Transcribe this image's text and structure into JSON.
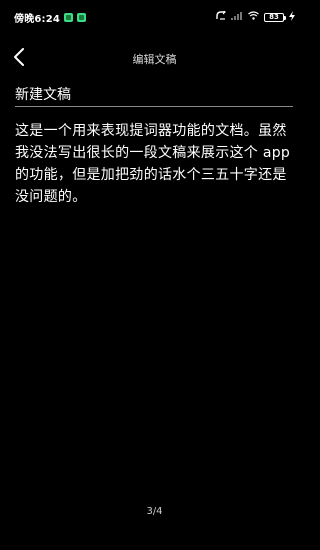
{
  "status_bar": {
    "time": "傍晚6:24",
    "battery": "83",
    "icons": [
      "notification-app-icon",
      "notification-app-icon",
      "data-activity-icon",
      "signal-icon",
      "wifi-icon",
      "battery-icon",
      "charging-icon"
    ]
  },
  "header": {
    "title": "编辑文稿",
    "back_icon": "chevron-left-icon"
  },
  "document": {
    "title": "新建文稿",
    "body": "这是一个用来表现提词器功能的文档。虽然我没法写出很长的一段文稿来展示这个 app 的功能，但是加把劲的话水个三五十字还是没问题的。"
  },
  "pagination": {
    "label": "3/4"
  },
  "colors": {
    "background": "#000000",
    "text": "#ffffff",
    "accent_notification": "#3ddc84"
  }
}
